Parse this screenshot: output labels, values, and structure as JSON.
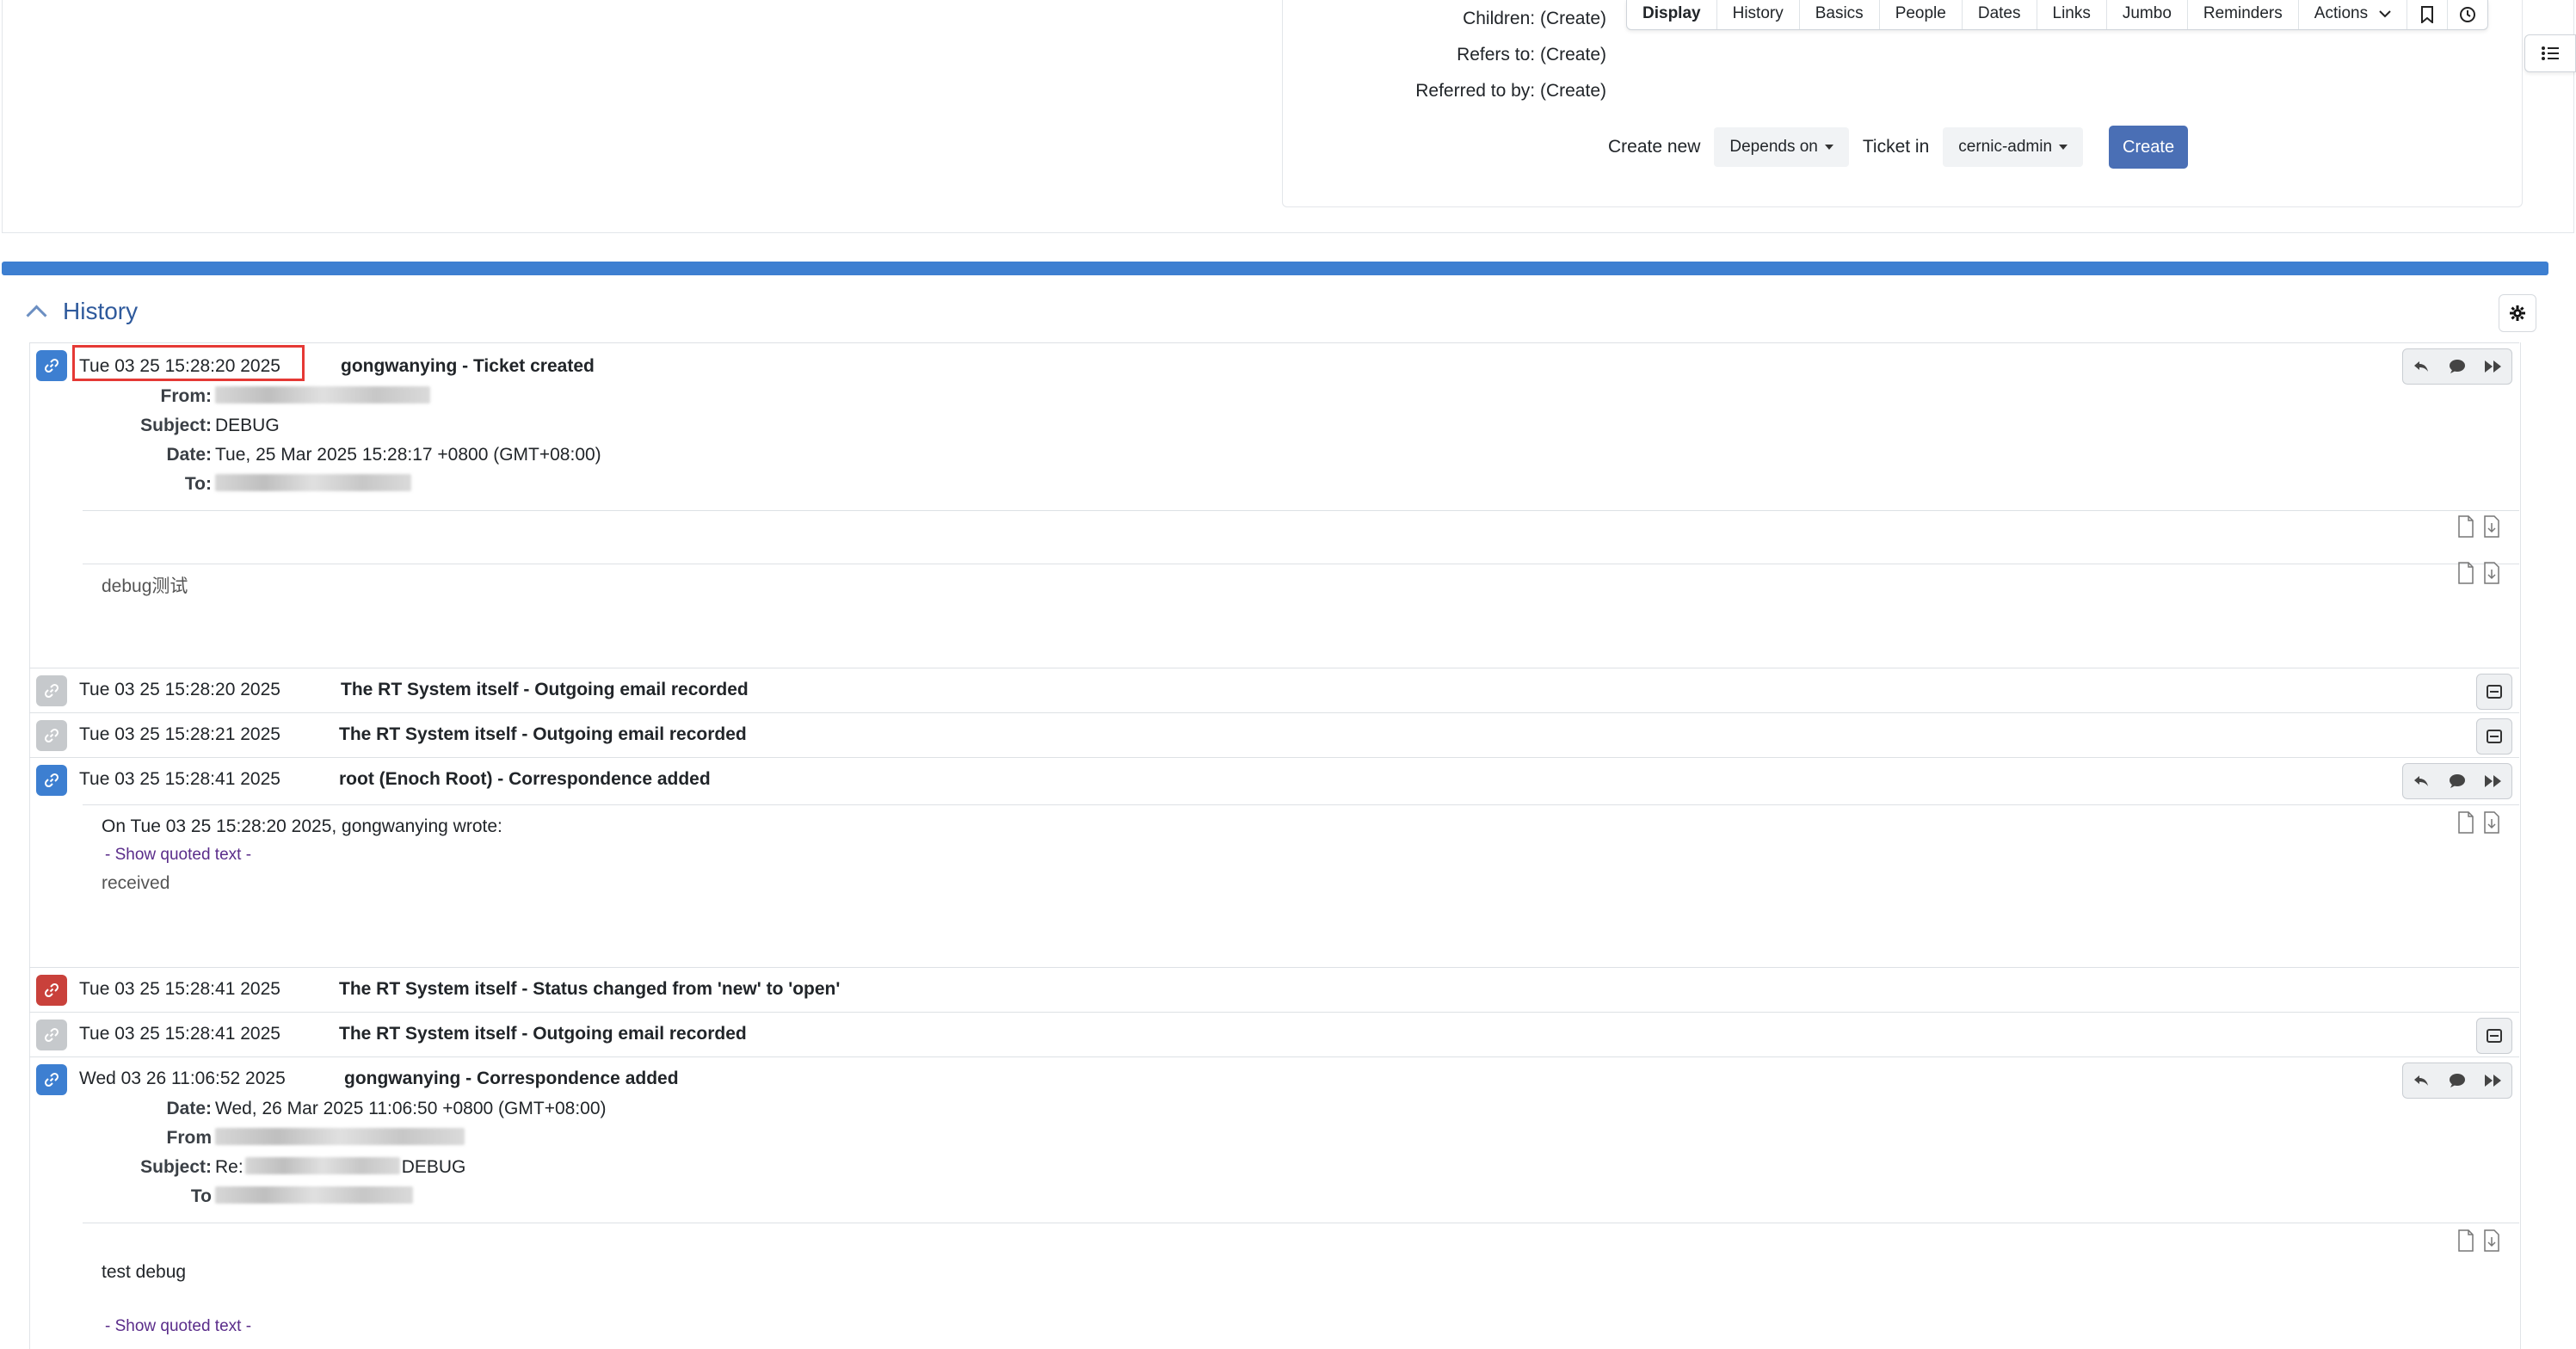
{
  "links": {
    "children_label": "Children:",
    "children_value": "(Create)",
    "refers_label": "Refers to:",
    "refers_value": "(Create)",
    "referred_label": "Referred to by:",
    "referred_value": "(Create)"
  },
  "create_new": {
    "label": "Create new",
    "relation": "Depends on",
    "ticket_in_label": "Ticket in",
    "queue": "cernic-admin",
    "button": "Create"
  },
  "tabs": [
    "Display",
    "History",
    "Basics",
    "People",
    "Dates",
    "Links",
    "Jumbo",
    "Reminders",
    "Actions"
  ],
  "history": {
    "title": "History",
    "transactions": [
      {
        "date": "Tue 03 25 15:28:20 2025",
        "description": "gongwanying - Ticket created",
        "headers": {
          "from_label": "From:",
          "subject_label": "Subject:",
          "subject": "DEBUG",
          "date_label": "Date:",
          "date": "Tue, 25 Mar 2025 15:28:17 +0800 (GMT+08:00)",
          "to_label": "To:"
        },
        "body": "debug测试"
      },
      {
        "date": "Tue 03 25 15:28:20 2025",
        "description": "The RT System itself - Outgoing email recorded"
      },
      {
        "date": "Tue 03 25 15:28:21 2025",
        "description": "The RT System itself - Outgoing email recorded"
      },
      {
        "date": "Tue 03 25 15:28:41 2025",
        "description": "root (Enoch Root) - Correspondence added",
        "quote_intro": "On Tue 03 25 15:28:20 2025, gongwanying wrote:",
        "show_quoted": "- Show quoted text -",
        "body": "received"
      },
      {
        "date": "Tue 03 25 15:28:41 2025",
        "description": "The RT System itself - Status changed from 'new' to 'open'"
      },
      {
        "date": "Tue 03 25 15:28:41 2025",
        "description": "The RT System itself - Outgoing email recorded"
      },
      {
        "date": "Wed 03 26 11:06:52 2025",
        "description": "gongwanying - Correspondence added",
        "headers": {
          "date_label": "Date:",
          "date": "Wed, 26 Mar 2025 11:06:50 +0800 (GMT+08:00)",
          "from_label": "From",
          "subject_label": "Subject:",
          "subject_prefix": "Re:",
          "subject_suffix": "DEBUG",
          "to_label": "To"
        },
        "body": "test debug",
        "show_quoted": "- Show quoted text -"
      }
    ]
  },
  "colors": {
    "accent_blue": "#3d7fd1",
    "create_button": "#4a6fb5",
    "status_red": "#c9413b",
    "system_grey": "#c6c9cc",
    "highlight_box": "#e53935"
  }
}
